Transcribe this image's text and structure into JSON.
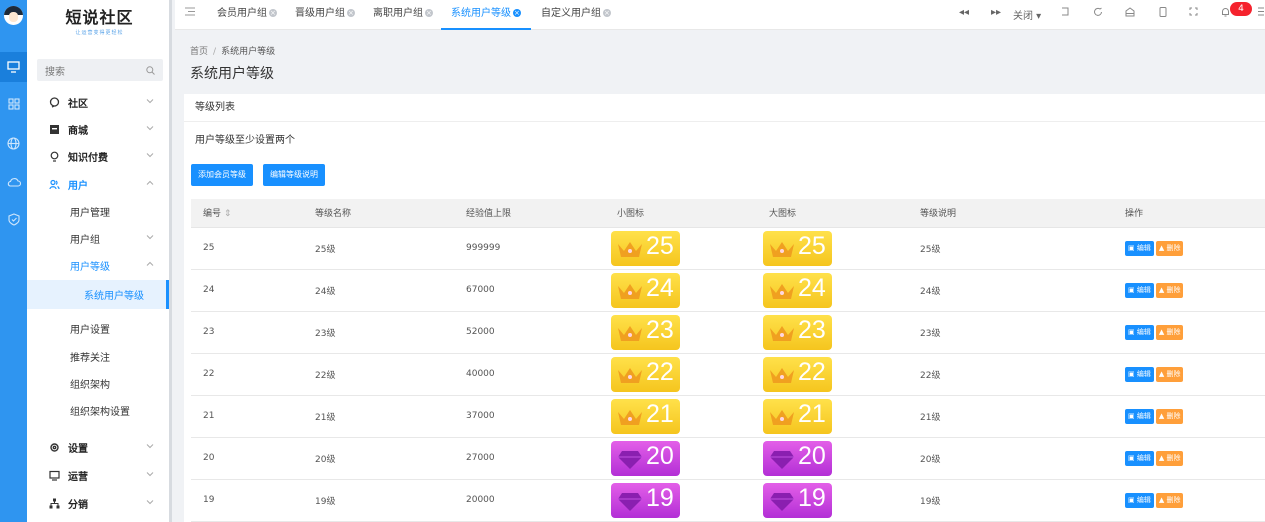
{
  "brand": {
    "title": "短说社区",
    "slogan": "让运营变得更轻松"
  },
  "sidebar": {
    "search_label": "搜索",
    "items": [
      {
        "label": "社区"
      },
      {
        "label": "商城"
      },
      {
        "label": "知识付费"
      },
      {
        "label": "用户"
      },
      {
        "label": "用户管理"
      },
      {
        "label": "用户组"
      },
      {
        "label": "用户等级"
      },
      {
        "label": "系统用户等级"
      },
      {
        "label": "用户设置"
      },
      {
        "label": "推荐关注"
      },
      {
        "label": "组织架构"
      },
      {
        "label": "组织架构设置"
      },
      {
        "label": "设置"
      },
      {
        "label": "运营"
      },
      {
        "label": "分销"
      }
    ]
  },
  "tabs": [
    {
      "label": "会员用户组"
    },
    {
      "label": "晋级用户组"
    },
    {
      "label": "离职用户组"
    },
    {
      "label": "系统用户等级"
    },
    {
      "label": "自定义用户组"
    }
  ],
  "toolbar": {
    "close_label": "关闭",
    "notification_count": "4"
  },
  "breadcrumb": {
    "home": "首页",
    "separator": "/",
    "current": "系统用户等级"
  },
  "page_title": "系统用户等级",
  "card": {
    "header": "等级列表",
    "note": "用户等级至少设置两个",
    "add_button": "添加会员等级",
    "edit_desc_button": "编辑等级说明"
  },
  "table": {
    "columns": [
      "编号",
      "等级名称",
      "经验值上限",
      "小图标",
      "大图标",
      "等级说明",
      "操作"
    ],
    "edit_label": "编辑",
    "delete_label": "删除",
    "rows": [
      {
        "id": "25",
        "name": "25级",
        "exp": "999999",
        "icon_num": "25",
        "icon_style": "crown-gold",
        "desc": "25级"
      },
      {
        "id": "24",
        "name": "24级",
        "exp": "67000",
        "icon_num": "24",
        "icon_style": "crown-gold",
        "desc": "24级"
      },
      {
        "id": "23",
        "name": "23级",
        "exp": "52000",
        "icon_num": "23",
        "icon_style": "crown-gold",
        "desc": "23级"
      },
      {
        "id": "22",
        "name": "22级",
        "exp": "40000",
        "icon_num": "22",
        "icon_style": "crown-gold",
        "desc": "22级"
      },
      {
        "id": "21",
        "name": "21级",
        "exp": "37000",
        "icon_num": "21",
        "icon_style": "crown-gold",
        "desc": "21级"
      },
      {
        "id": "20",
        "name": "20级",
        "exp": "27000",
        "icon_num": "20",
        "icon_style": "diamond-purple",
        "desc": "20级"
      },
      {
        "id": "19",
        "name": "19级",
        "exp": "20000",
        "icon_num": "19",
        "icon_style": "diamond-purple",
        "desc": "19级"
      }
    ]
  },
  "colors": {
    "accent": "#1890ff",
    "rail": "#2f95f0",
    "gold": "#f7c824",
    "purple": "#c33ddc",
    "delete": "#ff9f3a"
  }
}
